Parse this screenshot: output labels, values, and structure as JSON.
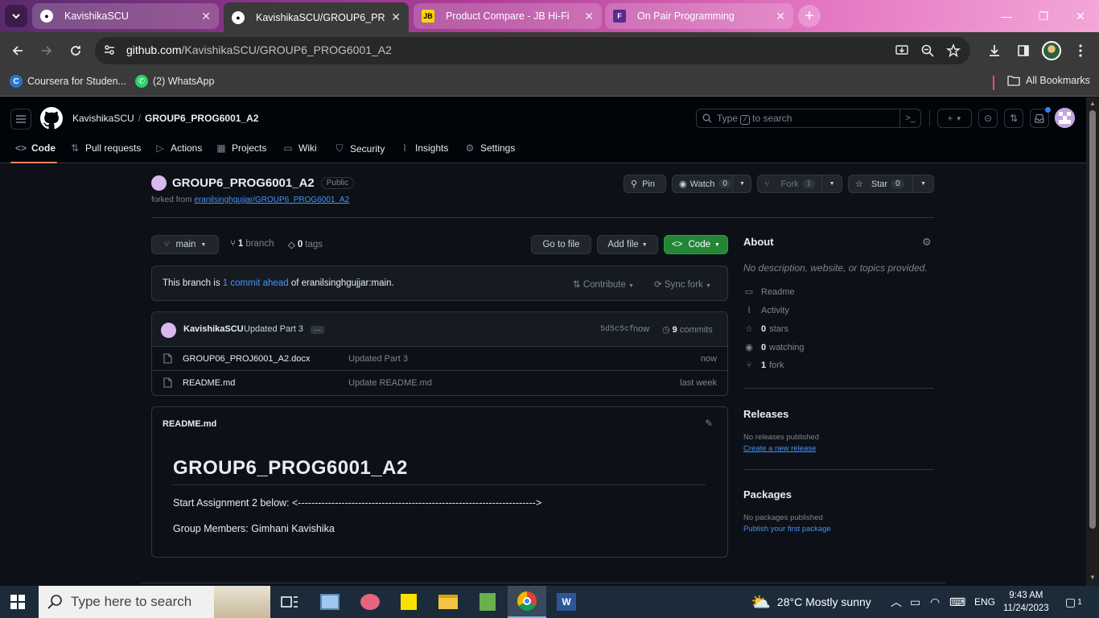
{
  "browser": {
    "tabs": [
      {
        "title": "KavishikaSCU",
        "active": false
      },
      {
        "title": "KavishikaSCU/GROUP6_PROG6001_A2",
        "active": true
      },
      {
        "title": "Product Compare - JB Hi-Fi",
        "active": false
      },
      {
        "title": "On Pair Programming",
        "active": false
      }
    ],
    "url_host": "github.com",
    "url_path": "/KavishikaSCU/GROUP6_PROG6001_A2",
    "bookmarks": [
      "Coursera for Studen...",
      "(2) WhatsApp"
    ],
    "all_bookmarks": "All Bookmarks"
  },
  "github": {
    "owner": "KavishikaSCU",
    "repo": "GROUP6_PROG6001_A2",
    "search_prefix": "Type",
    "search_key": "/",
    "search_suffix": "to search",
    "nav": [
      "Code",
      "Pull requests",
      "Actions",
      "Projects",
      "Wiki",
      "Security",
      "Insights",
      "Settings"
    ],
    "visibility": "Public",
    "forked_prefix": "forked from",
    "forked_from": "eranilsinghgujjar/GROUP6_PROG6001_A2",
    "pin": "Pin",
    "watch": "Watch",
    "watch_count": "0",
    "fork": "Fork",
    "fork_count": "1",
    "star": "Star",
    "star_count": "0",
    "branch": "main",
    "branches_count": "1",
    "branches_label": "branch",
    "tags_count": "0",
    "tags_label": "tags",
    "go_to_file": "Go to file",
    "add_file": "Add file",
    "code_btn": "Code",
    "ahead_prefix": "This branch is",
    "ahead_link": "1 commit ahead",
    "ahead_suffix": "of eranilsinghgujjar:main.",
    "contribute": "Contribute",
    "sync_fork": "Sync fork",
    "last_commit": {
      "author": "KavishikaSCU",
      "message": "Updated Part 3",
      "sha": "5d5c5cf",
      "time": "now",
      "commits_count": "9",
      "commits_label": "commits"
    },
    "files": [
      {
        "name": "GROUP06_PROJ6001_A2.docx",
        "message": "Updated Part 3",
        "time": "now"
      },
      {
        "name": "README.md",
        "message": "Update README.md",
        "time": "last week"
      }
    ],
    "readme": {
      "header": "README.md",
      "h1": "GROUP6_PROG6001_A2",
      "p1": "Start Assignment 2 below: <----------------------------------------------------------------------->",
      "p2": "Group Members: Gimhani Kavishika"
    },
    "about": {
      "title": "About",
      "description": "No description, website, or topics provided.",
      "readme": "Readme",
      "activity": "Activity",
      "stars_count": "0",
      "stars_label": "stars",
      "watching_count": "0",
      "watching_label": "watching",
      "forks_count": "1",
      "forks_label": "fork"
    },
    "releases": {
      "title": "Releases",
      "text": "No releases published",
      "link": "Create a new release"
    },
    "packages": {
      "title": "Packages",
      "text": "No packages published",
      "link": "Publish your first package"
    }
  },
  "taskbar": {
    "search_placeholder": "Type here to search",
    "weather": "28°C  Mostly sunny",
    "language": "ENG",
    "time": "9:43 AM",
    "date": "11/24/2023",
    "notifications": "1"
  },
  "colors": {
    "accent": "#4493f8",
    "green": "#238636",
    "underline": "#f78166"
  }
}
